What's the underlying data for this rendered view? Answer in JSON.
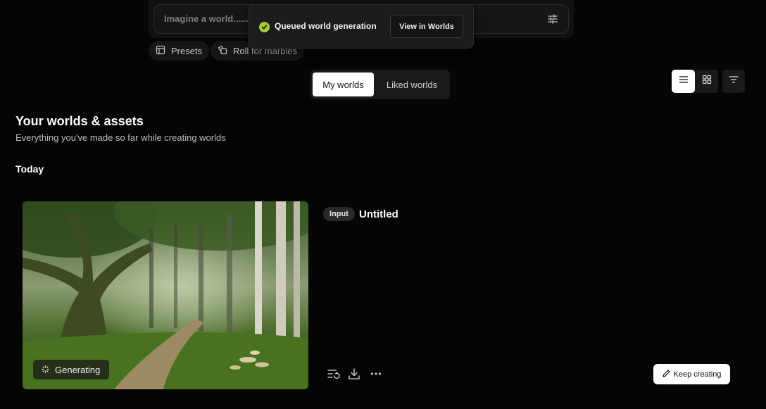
{
  "prompt": {
    "placeholder": "Imagine a world......"
  },
  "chips": {
    "presets": "Presets",
    "roll": "Roll for marbles"
  },
  "toast": {
    "message": "Queued world generation",
    "action": "View in Worlds",
    "accent": "#a3d12a"
  },
  "tabs": {
    "my": "My worlds",
    "liked": "Liked worlds"
  },
  "section": {
    "title": "Your worlds & assets",
    "subtitle": "Everything you've made so far while creating worlds"
  },
  "group": {
    "label": "Today"
  },
  "card": {
    "status": "Generating",
    "badge": "Input",
    "title": "Untitled"
  },
  "actions": {
    "keep_creating": "Keep creating"
  },
  "icons": [
    "sliders-icon",
    "presets-icon",
    "dice-icon",
    "check-icon",
    "list-view-icon",
    "grid-view-icon",
    "filter-icon",
    "spinner-icon",
    "restore-icon",
    "download-icon",
    "more-icon",
    "pencil-icon"
  ]
}
